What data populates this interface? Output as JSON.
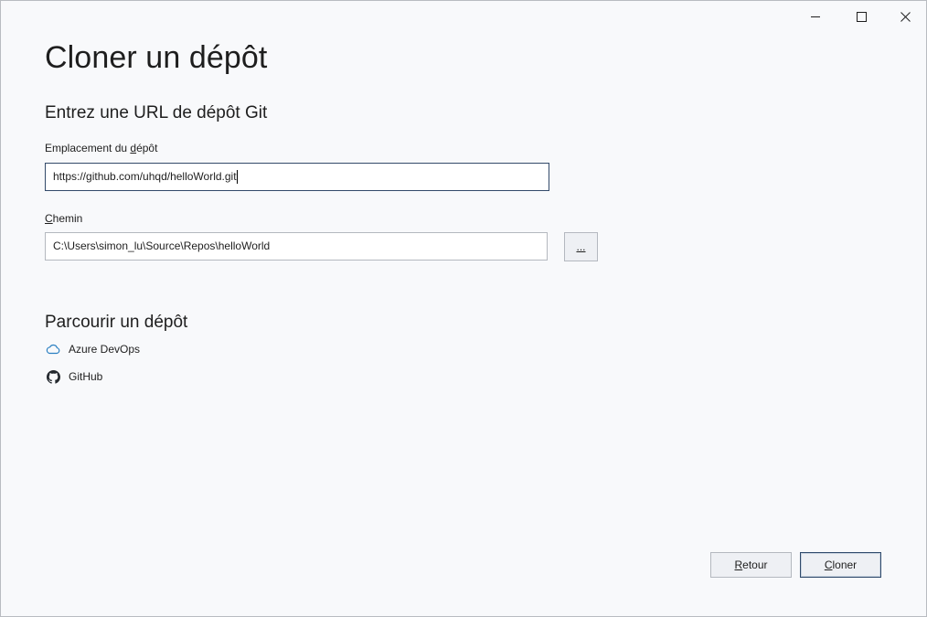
{
  "window": {
    "minimize_icon": "minimize-icon",
    "maximize_icon": "maximize-icon",
    "close_icon": "close-icon"
  },
  "page": {
    "title": "Cloner un dépôt"
  },
  "url_section": {
    "title": "Entrez une URL de dépôt Git",
    "location_label_prefix": "Emplacement du ",
    "location_label_access": "d",
    "location_label_suffix": "épôt",
    "location_value": "https://github.com/uhqd/helloWorld.git",
    "path_label_access": "C",
    "path_label_suffix": "hemin",
    "path_value": "C:\\Users\\simon_lu\\Source\\Repos\\helloWorld",
    "browse_label": "..."
  },
  "browse_section": {
    "title": "Parcourir un dépôt",
    "providers": [
      {
        "label": "Azure DevOps",
        "icon": "cloud-icon"
      },
      {
        "label": "GitHub",
        "icon": "github-icon"
      }
    ]
  },
  "actions": {
    "back_access": "R",
    "back_suffix": "etour",
    "clone_access": "C",
    "clone_suffix": "loner"
  },
  "colors": {
    "background": "#f8f9fb",
    "focus_border": "#334a6a",
    "azure_icon": "#2a7fc1"
  }
}
